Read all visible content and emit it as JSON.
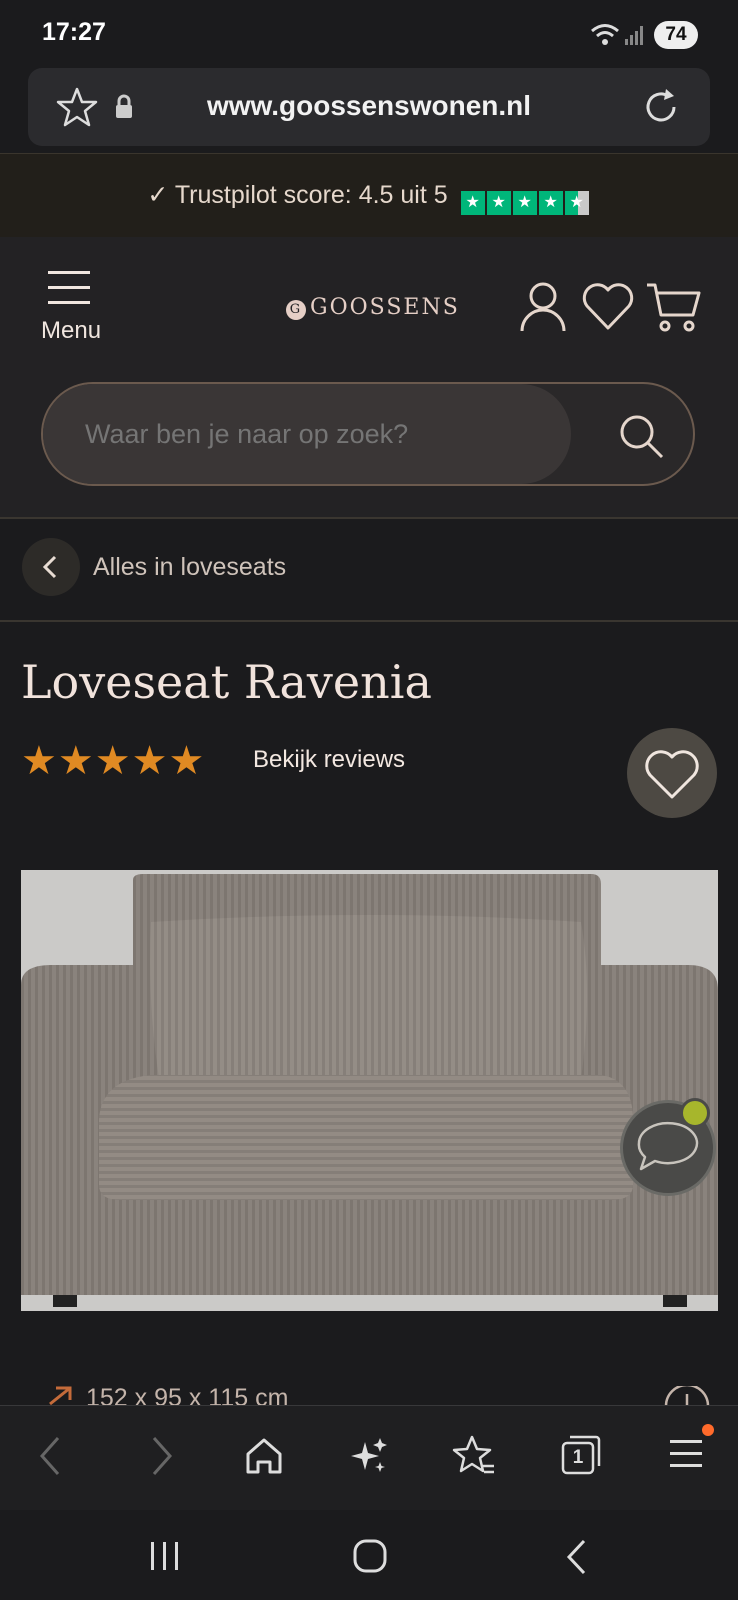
{
  "status_bar": {
    "time": "17:27",
    "battery": "74"
  },
  "browser": {
    "url": "www.goossenswonen.nl"
  },
  "trustpilot": {
    "text": "Trustpilot score: 4.5 uit 5",
    "rating": 4.5,
    "max": 5,
    "color": "#00b67a"
  },
  "header": {
    "menu_label": "Menu",
    "logo_text": "GOOSSENS",
    "logo_mark": "G",
    "search_placeholder": "Waar ben je naar op zoek?"
  },
  "breadcrumb": {
    "label": "Alles in loveseats"
  },
  "product": {
    "title": "Loveseat Ravenia",
    "rating_stars": 5,
    "reviews_link": "Bekijk reviews",
    "dimensions": "152 x 95 x 115 cm",
    "star_color": "#e08a23"
  },
  "bottom_bar": {
    "icons": [
      "back-icon",
      "forward-icon",
      "home-icon",
      "sparkle-icon",
      "bookmark-star-icon",
      "tabs-icon",
      "menu-icon"
    ],
    "tab_count": "1"
  },
  "android_nav": {
    "icons": [
      "recents-icon",
      "home-icon",
      "back-icon"
    ]
  }
}
